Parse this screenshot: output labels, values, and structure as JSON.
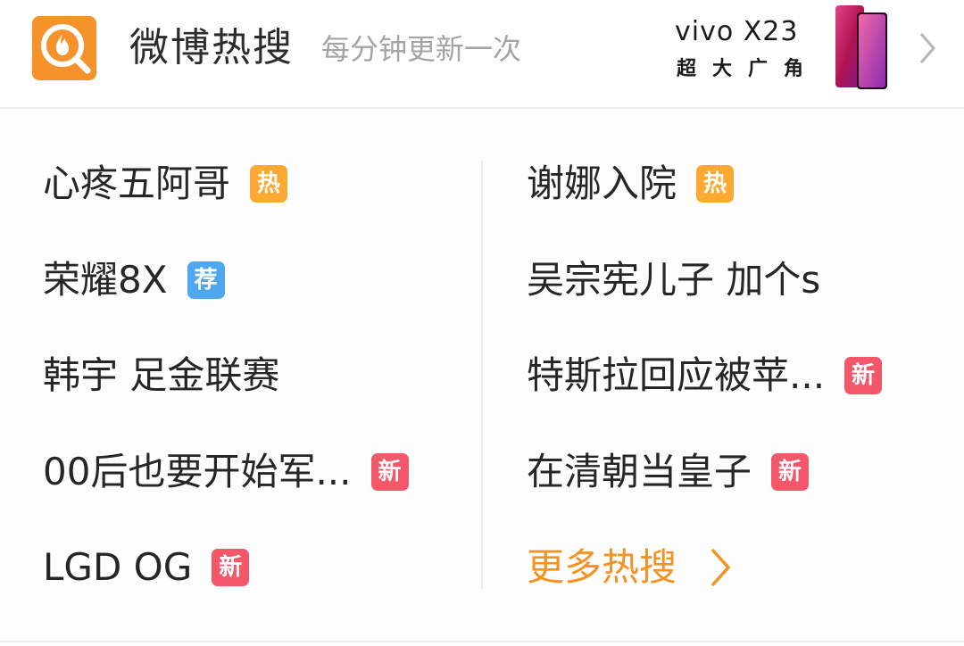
{
  "header": {
    "title": "微博热搜",
    "subtitle": "每分钟更新一次",
    "ad": {
      "brand": "vivo X23",
      "slogan": "超大广角"
    }
  },
  "left_items": [
    {
      "text": "心疼五阿哥",
      "badge": "热",
      "badge_type": "hot"
    },
    {
      "text": "荣耀8X",
      "badge": "荐",
      "badge_type": "rec"
    },
    {
      "text": "韩宇 足金联赛",
      "badge": "",
      "badge_type": ""
    },
    {
      "text": "00后也要开始军...",
      "badge": "新",
      "badge_type": "new"
    },
    {
      "text": "LGD OG",
      "badge": "新",
      "badge_type": "new"
    }
  ],
  "right_items": [
    {
      "text": "谢娜入院",
      "badge": "热",
      "badge_type": "hot"
    },
    {
      "text": "吴宗宪儿子 加个s",
      "badge": "",
      "badge_type": ""
    },
    {
      "text": "特斯拉回应被苹...",
      "badge": "新",
      "badge_type": "new"
    },
    {
      "text": "在清朝当皇子",
      "badge": "新",
      "badge_type": "new"
    }
  ],
  "more": {
    "label": "更多热搜"
  },
  "colors": {
    "logo": "#f5922a",
    "hot": "#fba932",
    "recommend": "#4ea7ef",
    "new": "#f2576a",
    "more": "#f39322"
  },
  "icons": {
    "logo": "weibo-search-flame-icon",
    "header_arrow": "chevron-right-icon",
    "more_arrow": "chevron-right-icon"
  }
}
